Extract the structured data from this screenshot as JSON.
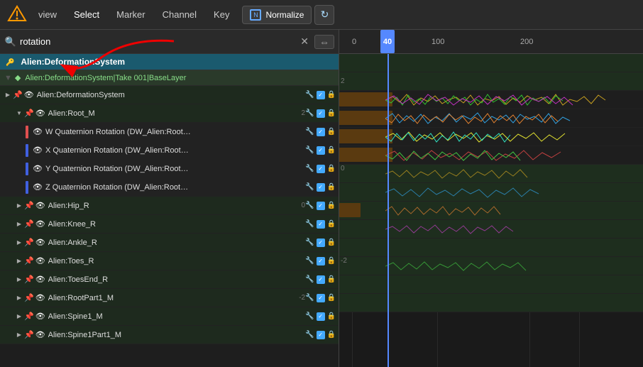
{
  "menu": {
    "logo": "⊠",
    "items": [
      "view",
      "Select",
      "Marker",
      "Channel",
      "Key"
    ],
    "normalize_label": "Normalize",
    "refresh_icon": "↻"
  },
  "search": {
    "placeholder": "rotation",
    "value": "rotation",
    "clear_icon": "✕",
    "swap_icon": "⇔"
  },
  "channel_header": {
    "text": "Alien:DeformationSystem"
  },
  "layer_row": {
    "text": "Alien:DeformationSystem|Take 001|BaseLayer"
  },
  "tracks": [
    {
      "id": 1,
      "indent": 1,
      "expanded": true,
      "icons": [
        "pin",
        "eye"
      ],
      "name": "Alien:DeformationSystem",
      "color": "",
      "bg": "dark"
    },
    {
      "id": 2,
      "indent": 2,
      "expanded": true,
      "icons": [
        "pin",
        "eye"
      ],
      "name": "Alien:Root_M",
      "color": "",
      "bg": "dark"
    },
    {
      "id": 3,
      "indent": 3,
      "expanded": false,
      "icons": [
        "eye"
      ],
      "name": "W Quaternion Rotation (DW_Alien:Root…",
      "color": "#e05050",
      "bg": "medium"
    },
    {
      "id": 4,
      "indent": 3,
      "expanded": false,
      "icons": [
        "eye"
      ],
      "name": "X Quaternion Rotation (DW_Alien:Root…",
      "color": "#4060e0",
      "bg": "medium"
    },
    {
      "id": 5,
      "indent": 3,
      "expanded": false,
      "icons": [
        "eye"
      ],
      "name": "Y Quaternion Rotation (DW_Alien:Root…",
      "color": "#4060e0",
      "bg": "medium"
    },
    {
      "id": 6,
      "indent": 3,
      "expanded": false,
      "icons": [
        "eye"
      ],
      "name": "Z Quaternion Rotation (DW_Alien:Root…",
      "color": "#4060e0",
      "bg": "medium"
    },
    {
      "id": 7,
      "indent": 2,
      "expanded": false,
      "icons": [
        "pin",
        "eye"
      ],
      "name": "Alien:Hip_R",
      "color": "",
      "bg": "dark"
    },
    {
      "id": 8,
      "indent": 2,
      "expanded": false,
      "icons": [
        "pin",
        "eye"
      ],
      "name": "Alien:Knee_R",
      "color": "",
      "bg": "dark"
    },
    {
      "id": 9,
      "indent": 2,
      "expanded": false,
      "icons": [
        "pin",
        "eye"
      ],
      "name": "Alien:Ankle_R",
      "color": "",
      "bg": "dark"
    },
    {
      "id": 10,
      "indent": 2,
      "expanded": false,
      "icons": [
        "pin",
        "eye"
      ],
      "name": "Alien:Toes_R",
      "color": "",
      "bg": "dark"
    },
    {
      "id": 11,
      "indent": 2,
      "expanded": false,
      "icons": [
        "pin",
        "eye"
      ],
      "name": "Alien:ToesEnd_R",
      "color": "",
      "bg": "dark"
    },
    {
      "id": 12,
      "indent": 2,
      "expanded": false,
      "icons": [
        "pin",
        "eye"
      ],
      "name": "Alien:RootPart1_M",
      "color": "",
      "bg": "dark"
    },
    {
      "id": 13,
      "indent": 2,
      "expanded": false,
      "icons": [
        "pin",
        "eye"
      ],
      "name": "Alien:Spine1_M",
      "color": "",
      "bg": "dark"
    },
    {
      "id": 14,
      "indent": 2,
      "expanded": false,
      "icons": [
        "pin",
        "eye"
      ],
      "name": "Alien:Spine1Part1_M",
      "color": "",
      "bg": "dark"
    }
  ],
  "timeline": {
    "ruler_labels": [
      "0",
      "40",
      "100",
      "200"
    ],
    "current_frame": "40",
    "y_labels": [
      "2",
      "0",
      "-2"
    ]
  },
  "colors": {
    "accent_blue": "#5588ff",
    "bg_dark": "#1e1e1e",
    "bg_header": "#1a5a6e",
    "track_dark": "#1e2e1e",
    "track_medium": "#222222"
  }
}
